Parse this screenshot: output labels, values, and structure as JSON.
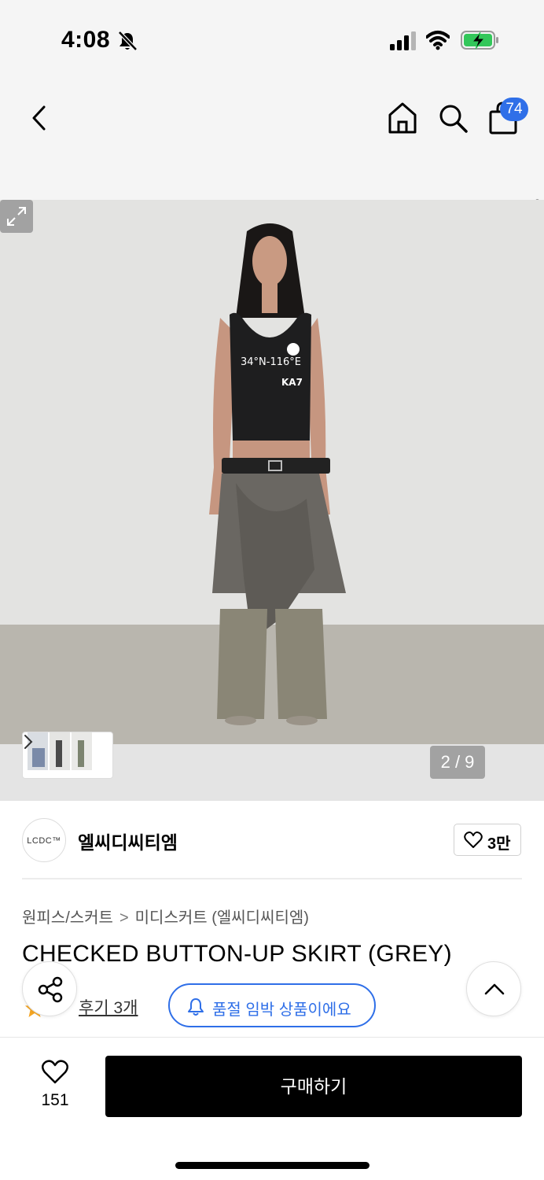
{
  "status_bar": {
    "time": "4:08"
  },
  "nav": {
    "cart_count": "74"
  },
  "gallery": {
    "counter": "2 / 9",
    "print_line1": "34°N-116°E",
    "print_line2": "KA7"
  },
  "brand": {
    "logo_text": "LCDC™",
    "name": "엘씨디씨티엠",
    "likes": "3만"
  },
  "breadcrumb": {
    "category": "원피스/스커트",
    "separator": ">",
    "subcategory": "미디스커트 (엘씨디씨티엠)"
  },
  "product": {
    "title": "CHECKED BUTTON-UP SKIRT (GREY)",
    "reviews_label": "후기 3개",
    "soldout_notice": "품절 임박 상품이에요"
  },
  "bottom_bar": {
    "wish_count": "151",
    "buy_label": "구매하기"
  },
  "colors": {
    "accent_blue": "#2f6fe8",
    "buy_button": "#000000",
    "star": "#f5a623"
  }
}
